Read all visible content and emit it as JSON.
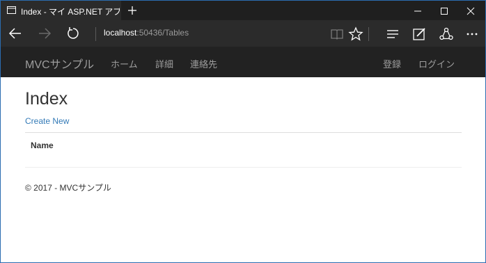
{
  "browser": {
    "tab_title": "Index - マイ ASP.NET アプ",
    "address_host": "localhost",
    "address_path": ":50436/Tables"
  },
  "site": {
    "brand": "MVCサンプル",
    "nav": [
      "ホーム",
      "詳細",
      "連絡先"
    ],
    "auth": [
      "登録",
      "ログイン"
    ]
  },
  "page": {
    "heading": "Index",
    "create_link": "Create New",
    "table_header": "Name",
    "footer": "© 2017 - MVCサンプル"
  },
  "colors": {
    "navbar": "#222222",
    "link": "#337ab7",
    "browser_chrome": "#2b2b2b"
  },
  "icons": [
    "tab-page-icon",
    "new-tab-icon",
    "minimize-icon",
    "maximize-icon",
    "close-icon",
    "back-icon",
    "forward-icon",
    "refresh-icon",
    "reading-view-icon",
    "favorite-star-icon",
    "hub-icon",
    "web-note-icon",
    "share-icon",
    "more-icon"
  ]
}
